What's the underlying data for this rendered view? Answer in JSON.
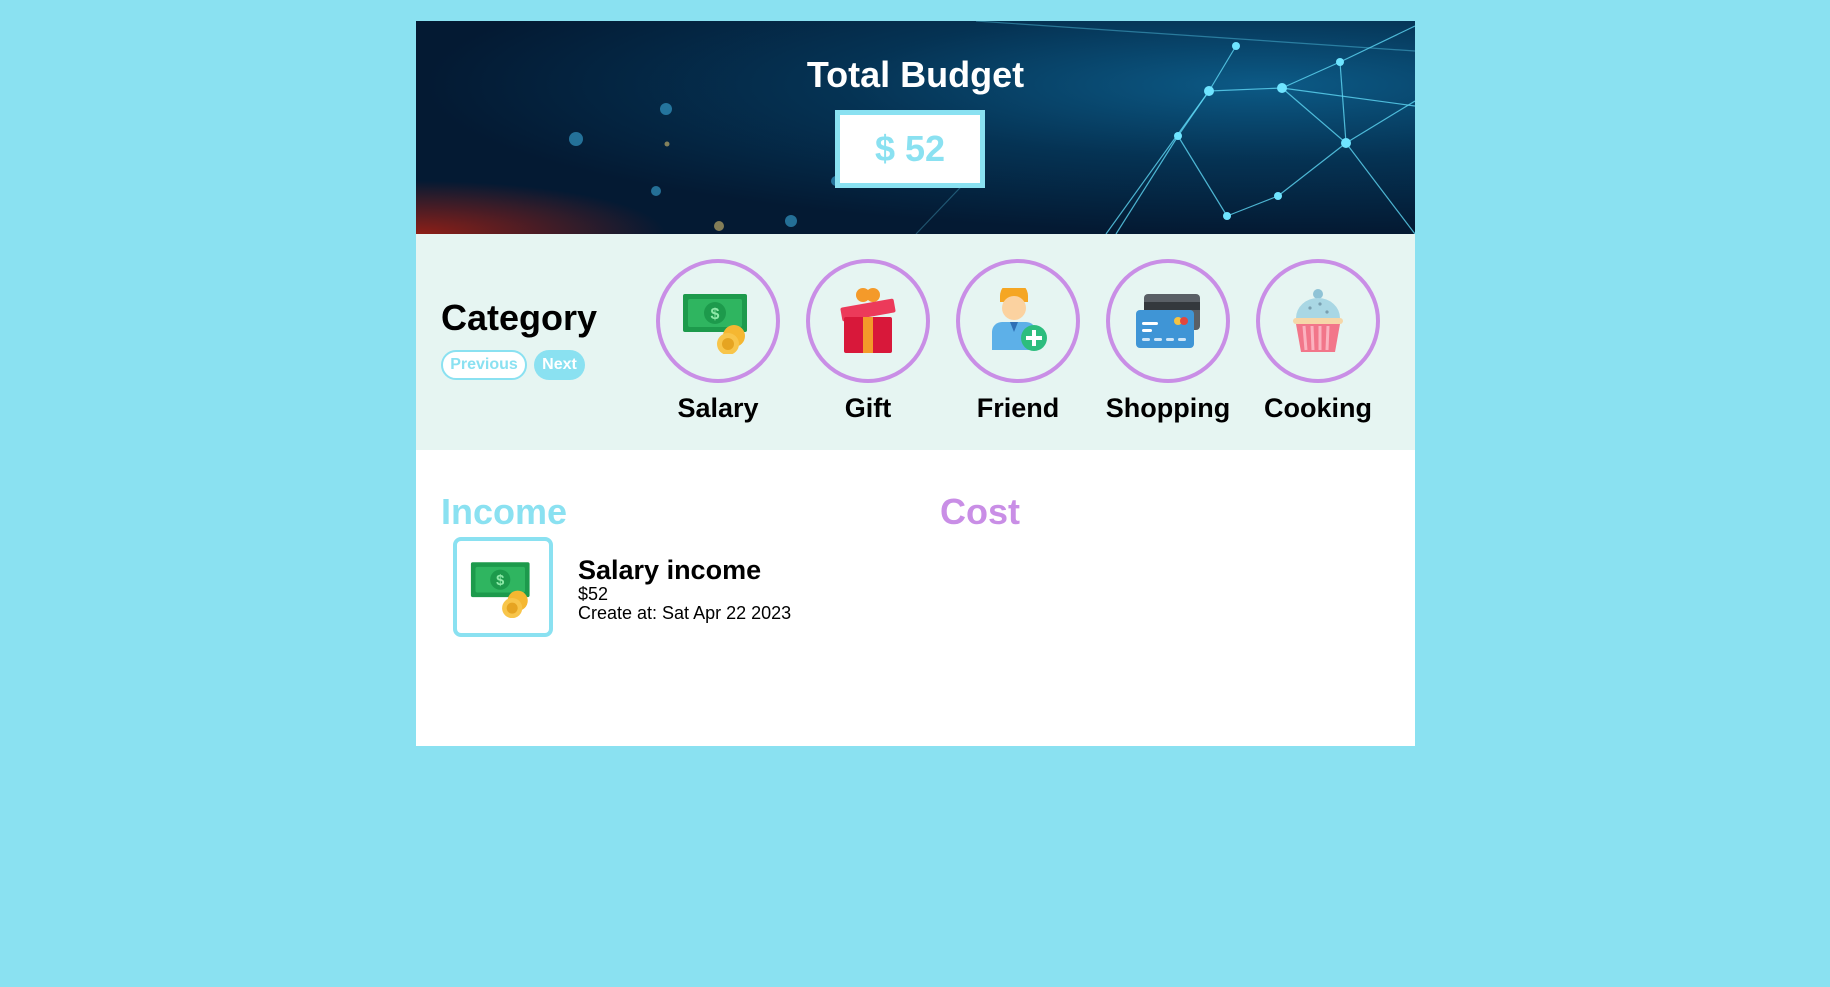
{
  "header": {
    "title": "Total Budget",
    "amount": "$ 52"
  },
  "category": {
    "title": "Category",
    "previous_label": "Previous",
    "next_label": "Next",
    "items": [
      {
        "label": "Salary",
        "icon": "money-icon"
      },
      {
        "label": "Gift",
        "icon": "gift-icon"
      },
      {
        "label": "Friend",
        "icon": "friend-add-icon"
      },
      {
        "label": "Shopping",
        "icon": "credit-card-icon"
      },
      {
        "label": "Cooking",
        "icon": "cupcake-icon"
      }
    ]
  },
  "income": {
    "title": "Income",
    "entries": [
      {
        "name": "Salary income",
        "amount": "$52",
        "created": "Create at: Sat Apr 22 2023",
        "icon": "money-icon"
      }
    ]
  },
  "cost": {
    "title": "Cost",
    "entries": []
  },
  "colors": {
    "background": "#8ae1f1",
    "income_accent": "#8ae1f1",
    "cost_accent": "#c98ee6",
    "category_bg": "#e6f5f2"
  }
}
